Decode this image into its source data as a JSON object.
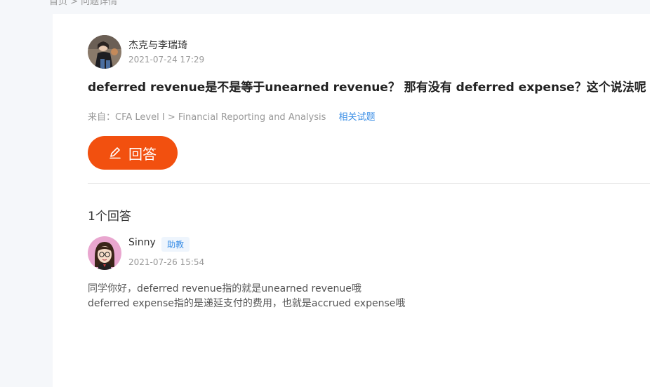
{
  "breadcrumb": "首页 > 问题详情",
  "question": {
    "author": "杰克与李瑞琦",
    "time": "2021-07-24 17:29",
    "title": "deferred revenue是不是等于unearned revenue？ 那有没有 deferred expense？这个说法呢",
    "source_prefix": "来自：",
    "source_path": "CFA Level I > Financial Reporting and Analysis",
    "related_link": "相关试题"
  },
  "answer_button": {
    "label": "回答",
    "icon": "pencil-icon",
    "color": "#f2500f"
  },
  "answers": {
    "count_label": "1个回答",
    "items": [
      {
        "author": "Sinny",
        "role": "助教",
        "time": "2021-07-26 15:54",
        "lines": [
          "同学你好，deferred revenue指的就是unearned revenue哦",
          "deferred expense指的是递延支付的费用，也就是accrued expense哦"
        ]
      }
    ]
  }
}
